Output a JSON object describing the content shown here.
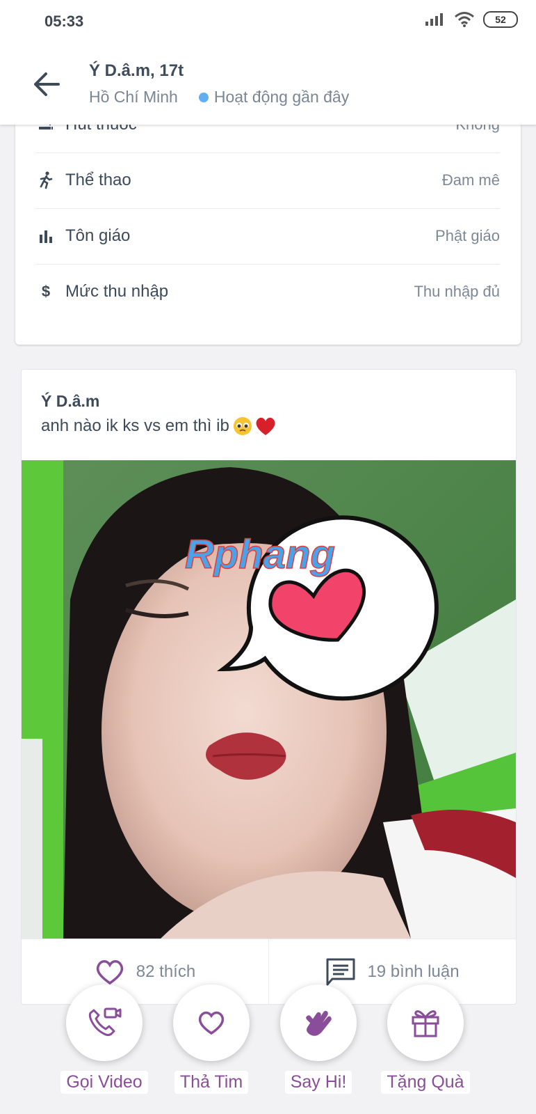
{
  "status_bar": {
    "time": "05:33",
    "battery": "52"
  },
  "header": {
    "name": "Ý D.â.m, 17t",
    "city": "Hồ Chí Minh",
    "activity": "Hoạt động gần đây"
  },
  "profile_info": [
    {
      "label": "Hút thuốc",
      "value": "Không",
      "icon": "smoking-icon"
    },
    {
      "label": "Thể thao",
      "value": "Đam mê",
      "icon": "running-icon"
    },
    {
      "label": "Tôn giáo",
      "value": "Phật giáo",
      "icon": "bar-chart-icon"
    },
    {
      "label": "Mức thu nhập",
      "value": "Thu nhập đủ",
      "icon": "dollar-icon"
    }
  ],
  "post": {
    "author": "Ý D.â.m",
    "text": "anh nào ik ks vs em thì ib",
    "watermark": "Rphang",
    "likes": "82 thích",
    "comments": "19 bình luận"
  },
  "actions": [
    {
      "label": "Gọi Video",
      "icon": "video-call-icon"
    },
    {
      "label": "Thả Tim",
      "icon": "heart-icon"
    },
    {
      "label": "Say Hi!",
      "icon": "wave-hand-icon"
    },
    {
      "label": "Tặng Quà",
      "icon": "gift-icon"
    }
  ],
  "colors": {
    "accent": "#8a4d9a",
    "online": "#62aef0"
  }
}
